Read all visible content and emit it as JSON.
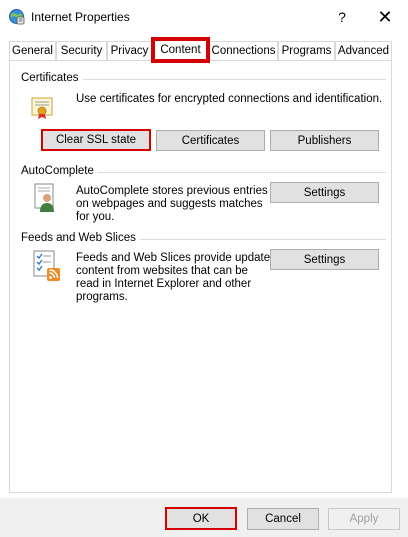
{
  "window": {
    "title": "Internet Properties",
    "help_glyph": "?",
    "close_glyph": "✕"
  },
  "tabs": [
    {
      "label": "General"
    },
    {
      "label": "Security"
    },
    {
      "label": "Privacy"
    },
    {
      "label": "Content"
    },
    {
      "label": "Connections"
    },
    {
      "label": "Programs"
    },
    {
      "label": "Advanced"
    }
  ],
  "active_tab": "Content",
  "highlight_color": "#d50000",
  "certificates": {
    "heading": "Certificates",
    "description": "Use certificates for encrypted connections and identification.",
    "buttons": {
      "clear_ssl": "Clear SSL state",
      "certificates": "Certificates",
      "publishers": "Publishers"
    }
  },
  "autocomplete": {
    "heading": "AutoComplete",
    "description_lines": [
      "AutoComplete stores previous entries",
      "on webpages and suggests matches",
      "for you."
    ],
    "settings_label": "Settings"
  },
  "feeds": {
    "heading": "Feeds and Web Slices",
    "description_lines": [
      "Feeds and Web Slices provide updated",
      "content from websites that can be",
      "read in Internet Explorer and other",
      "programs."
    ],
    "settings_label": "Settings"
  },
  "footer": {
    "ok": "OK",
    "cancel": "Cancel",
    "apply": "Apply"
  }
}
